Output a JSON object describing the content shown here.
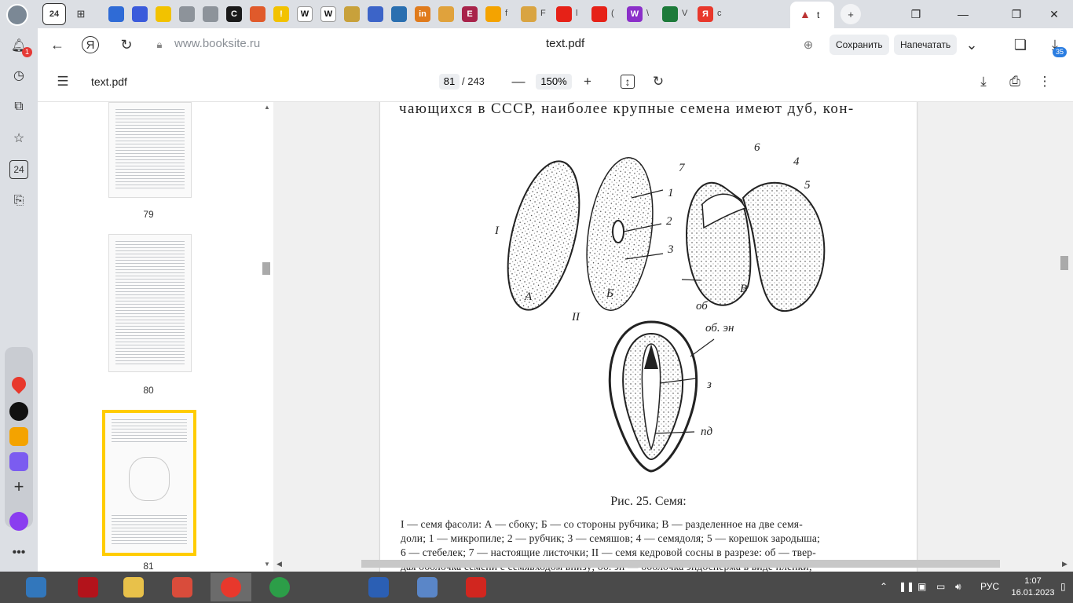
{
  "tabs": {
    "first_tab_label": "24",
    "items": [
      {
        "icon": "google-drive-icon",
        "color": "#2f6bd6"
      },
      {
        "icon": "font-icon",
        "color": "#3b5bdb"
      },
      {
        "icon": "lightbulb-icon",
        "color": "#f2c200"
      },
      {
        "icon": "document-icon",
        "color": "#8d939a"
      },
      {
        "icon": "document-icon",
        "color": "#8d939a"
      },
      {
        "icon": "c-icon",
        "color": "#1a1a1a",
        "letter": "C"
      },
      {
        "icon": "arrow-icon",
        "color": "#e05a2b"
      },
      {
        "icon": "exclamation-icon",
        "color": "#f2c200",
        "letter": "!"
      },
      {
        "icon": "wikipedia-icon",
        "color": "#ffffff",
        "letter": "W"
      },
      {
        "icon": "wikipedia-icon",
        "color": "#ffffff",
        "letter": "W"
      },
      {
        "icon": "emblem-icon",
        "color": "#c8a13b"
      },
      {
        "icon": "flag-icon",
        "color": "#3c64c8"
      },
      {
        "icon": "globe-icon",
        "color": "#2a6fb0"
      },
      {
        "icon": "in-icon",
        "color": "#e07b1c",
        "letter": "in"
      },
      {
        "icon": "stripes-icon",
        "color": "#e0a23c"
      },
      {
        "icon": "e-icon",
        "color": "#a8234a",
        "letter": "E"
      },
      {
        "icon": "mail-icon",
        "color": "#f4a300",
        "title": "f"
      },
      {
        "icon": "v-icon",
        "color": "#d9a441",
        "title": "F"
      },
      {
        "icon": "youtube-icon",
        "color": "#e62117",
        "title": "l"
      },
      {
        "icon": "youtube-icon",
        "color": "#e62117",
        "title": "("
      },
      {
        "icon": "w-icon",
        "color": "#8b2fc9",
        "letter": "W",
        "title": "\\"
      },
      {
        "icon": "circle-icon",
        "color": "#1d7a3a",
        "title": "V"
      },
      {
        "icon": "yandex-icon",
        "color": "#e8382c",
        "letter": "Я",
        "title": "c"
      }
    ],
    "active_tab": {
      "icon": "pdf-reader-icon",
      "title": "t"
    }
  },
  "window_controls": {
    "restore": "▢",
    "minimize": "—",
    "maximize": "❐",
    "close": "✕"
  },
  "notifications_badge": "1",
  "addressbar": {
    "host": "www.booksite.ru",
    "page_title": "text.pdf",
    "save_button": "Сохранить",
    "print_button": "Напечатать",
    "downloads_badge": "35"
  },
  "pdf_toolbar": {
    "title": "text.pdf",
    "current_page": "81",
    "total_pages": "/ 243",
    "zoom": "150%"
  },
  "thumbnails": [
    {
      "number": "79",
      "selected": false
    },
    {
      "number": "80",
      "selected": false
    },
    {
      "number": "81",
      "selected": true
    }
  ],
  "document": {
    "top_line": "чающихся в СССР, наиболее крупные семена имеют дуб, кон-",
    "figure_labels": {
      "roman_1": "I",
      "roman_2": "II",
      "sub_a": "А",
      "sub_b": "Б",
      "sub_v": "В",
      "n1": "1",
      "n2": "2",
      "n3": "3",
      "n4": "4",
      "n5": "5",
      "n6": "6",
      "n7": "7",
      "ob": "об",
      "oben": "об. эн",
      "z": "з",
      "pd": "пд"
    },
    "caption": "Рис. 25. Семя:",
    "legend": [
      "I — семя фасоли: А — сбоку; Б — со стороны рубчика; В — разделенное на две семя-",
      "доли; 1 — микропиле; 2 — рубчик; 3 — семяшов; 4 — семядоля; 5 — корешок зародыша;",
      "6 — стебелек; 7 — настоящие листочки; II — семя кедровой сосны в разрезе: об — твер-",
      "дая оболочка семени с семявходом внизу; об. эн — оболочка эндосперма в виде пленки;"
    ]
  },
  "taskbar": {
    "apps": [
      {
        "icon": "edge-icon",
        "color": "#3277bc"
      },
      {
        "icon": "power-icon",
        "color": "#b3131b"
      },
      {
        "icon": "file-manager-icon",
        "color": "#e8c14a"
      },
      {
        "icon": "paint-icon",
        "color": "#d94c3b"
      },
      {
        "icon": "yandex-browser-icon",
        "color": "#e8382c",
        "active": true
      },
      {
        "icon": "chrome-icon",
        "color": "#2c9e48"
      },
      {
        "icon": "word-icon",
        "color": "#2b5fb4"
      },
      {
        "icon": "search-tool-icon",
        "color": "#5a86c8"
      },
      {
        "icon": "acrobat-icon",
        "color": "#d1261f"
      }
    ],
    "language": "РУС",
    "time": "1:07",
    "date": "16.01.2023"
  }
}
